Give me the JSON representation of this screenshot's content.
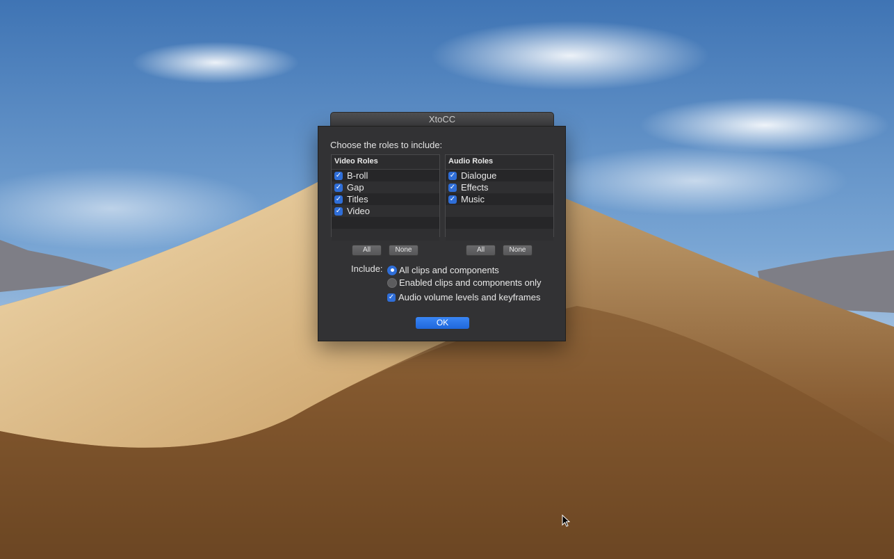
{
  "window": {
    "title": "XtoCC"
  },
  "dialog": {
    "prompt": "Choose the roles to include:",
    "video_roles": {
      "header": "Video Roles",
      "items": [
        {
          "label": "B-roll",
          "checked": true
        },
        {
          "label": "Gap",
          "checked": true
        },
        {
          "label": "Titles",
          "checked": true
        },
        {
          "label": "Video",
          "checked": true
        }
      ],
      "all_label": "All",
      "none_label": "None"
    },
    "audio_roles": {
      "header": "Audio Roles",
      "items": [
        {
          "label": "Dialogue",
          "checked": true
        },
        {
          "label": "Effects",
          "checked": true
        },
        {
          "label": "Music",
          "checked": true
        }
      ],
      "all_label": "All",
      "none_label": "None"
    },
    "include": {
      "label": "Include:",
      "options": [
        {
          "label": "All clips and components",
          "selected": true
        },
        {
          "label": "Enabled clips and components only",
          "selected": false
        }
      ],
      "audio_volume": {
        "label": "Audio volume levels and keyframes",
        "checked": true
      }
    },
    "ok_label": "OK"
  },
  "colors": {
    "accent": "#2f6ed8",
    "dialog_bg": "#323234"
  },
  "icons": {
    "checkbox": "checkmark-icon",
    "cursor": "arrow-cursor-icon"
  }
}
